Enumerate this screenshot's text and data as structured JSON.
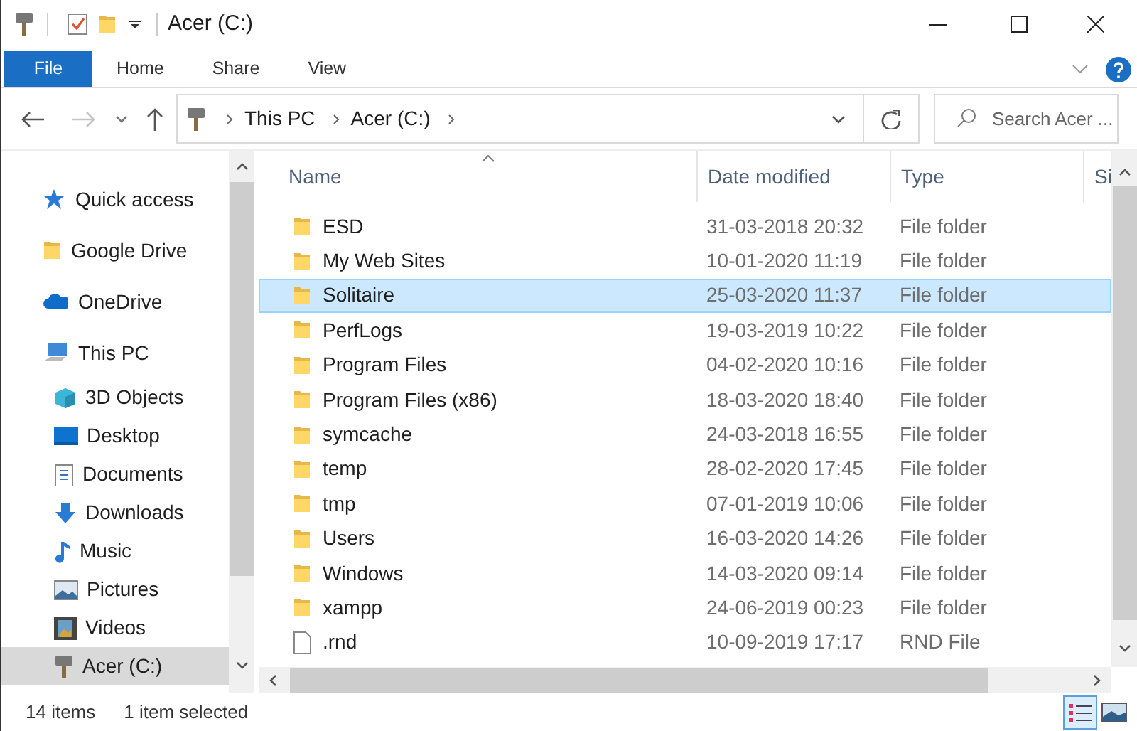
{
  "window": {
    "title": "Acer (C:)"
  },
  "ribbon": {
    "file_button": "File",
    "tabs": [
      "Home",
      "Share",
      "View"
    ]
  },
  "address_bar": {
    "crumbs": [
      "This PC",
      "Acer (C:)"
    ]
  },
  "search": {
    "placeholder": "Search Acer ..."
  },
  "sidebar": {
    "items": [
      {
        "label": "Quick access",
        "kind": "quick",
        "selected": false
      },
      {
        "label": "Google Drive",
        "kind": "folder",
        "selected": false
      },
      {
        "label": "OneDrive",
        "kind": "cloud",
        "selected": false
      },
      {
        "label": "This PC",
        "kind": "pc",
        "selected": false,
        "children": [
          {
            "label": "3D Objects",
            "kind": "cube",
            "selected": false
          },
          {
            "label": "Desktop",
            "kind": "desktop",
            "selected": false
          },
          {
            "label": "Documents",
            "kind": "documents",
            "selected": false
          },
          {
            "label": "Downloads",
            "kind": "downloads",
            "selected": false
          },
          {
            "label": "Music",
            "kind": "music",
            "selected": false
          },
          {
            "label": "Pictures",
            "kind": "pictures",
            "selected": false
          },
          {
            "label": "Videos",
            "kind": "videos",
            "selected": false
          },
          {
            "label": "Acer (C:)",
            "kind": "drive",
            "selected": true
          }
        ]
      }
    ]
  },
  "files": {
    "columns": [
      {
        "label": "Name",
        "sorted": true
      },
      {
        "label": "Date modified",
        "sorted": false
      },
      {
        "label": "Type",
        "sorted": false
      },
      {
        "label": "Si",
        "sorted": false
      }
    ],
    "rows": [
      {
        "name": "ESD",
        "date": "31-03-2018 20:32",
        "type": "File folder",
        "kind": "folder",
        "selected": false
      },
      {
        "name": "My Web Sites",
        "date": "10-01-2020 11:19",
        "type": "File folder",
        "kind": "folder",
        "selected": false
      },
      {
        "name": "Solitaire",
        "date": "25-03-2020 11:37",
        "type": "File folder",
        "kind": "folder",
        "selected": true
      },
      {
        "name": "PerfLogs",
        "date": "19-03-2019 10:22",
        "type": "File folder",
        "kind": "folder",
        "selected": false
      },
      {
        "name": "Program Files",
        "date": "04-02-2020 10:16",
        "type": "File folder",
        "kind": "folder",
        "selected": false
      },
      {
        "name": "Program Files (x86)",
        "date": "18-03-2020 18:40",
        "type": "File folder",
        "kind": "folder",
        "selected": false
      },
      {
        "name": "symcache",
        "date": "24-03-2018 16:55",
        "type": "File folder",
        "kind": "folder",
        "selected": false
      },
      {
        "name": "temp",
        "date": "28-02-2020 17:45",
        "type": "File folder",
        "kind": "folder",
        "selected": false
      },
      {
        "name": "tmp",
        "date": "07-01-2019 10:06",
        "type": "File folder",
        "kind": "folder",
        "selected": false
      },
      {
        "name": "Users",
        "date": "16-03-2020 14:26",
        "type": "File folder",
        "kind": "folder",
        "selected": false
      },
      {
        "name": "Windows",
        "date": "14-03-2020 09:14",
        "type": "File folder",
        "kind": "folder",
        "selected": false
      },
      {
        "name": "xampp",
        "date": "24-06-2019 00:23",
        "type": "File folder",
        "kind": "folder",
        "selected": false
      },
      {
        "name": ".rnd",
        "date": "10-09-2019 17:17",
        "type": "RND File",
        "kind": "file",
        "selected": false
      }
    ]
  },
  "status_bar": {
    "item_count": "14 items",
    "selection": "1 item selected"
  },
  "view_buttons": [
    {
      "kind": "details",
      "selected": true
    },
    {
      "kind": "large_icons",
      "selected": false
    }
  ]
}
